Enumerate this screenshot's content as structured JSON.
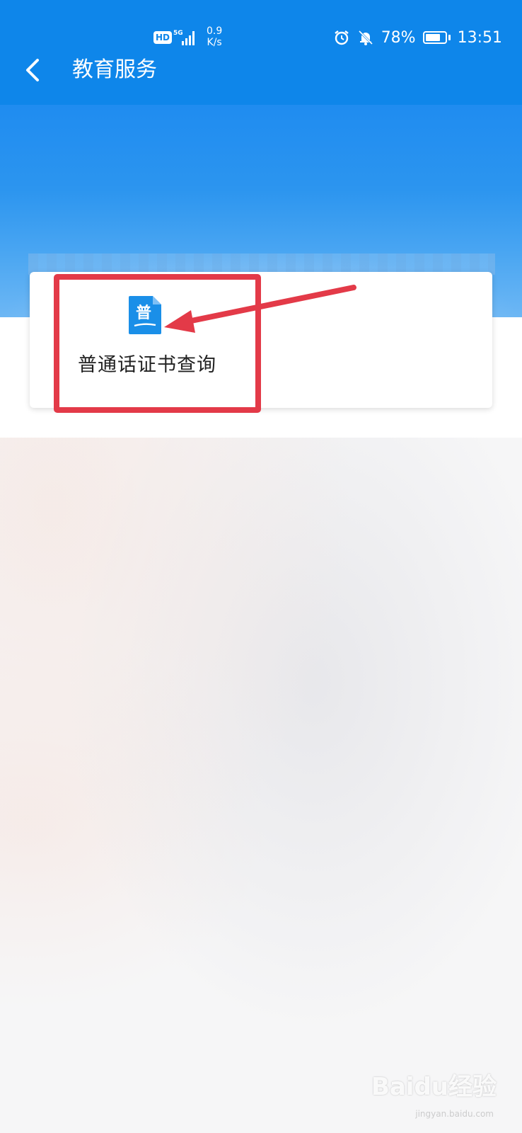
{
  "status_bar": {
    "hd": "HD",
    "network": "5G",
    "speed_value": "0.9",
    "speed_unit": "K/s",
    "battery_percent": "78%",
    "battery_level": 0.78,
    "time": "13:51"
  },
  "nav": {
    "title": "教育服务"
  },
  "services": [
    {
      "label": "普通话证书查询",
      "icon_char": "普"
    }
  ],
  "watermark": {
    "brand": "Baidu经验",
    "url": "jingyan.baidu.com"
  },
  "colors": {
    "header_blue": "#0e86ea",
    "annotation_red": "#e33a48",
    "icon_blue": "#1a8fe8"
  }
}
